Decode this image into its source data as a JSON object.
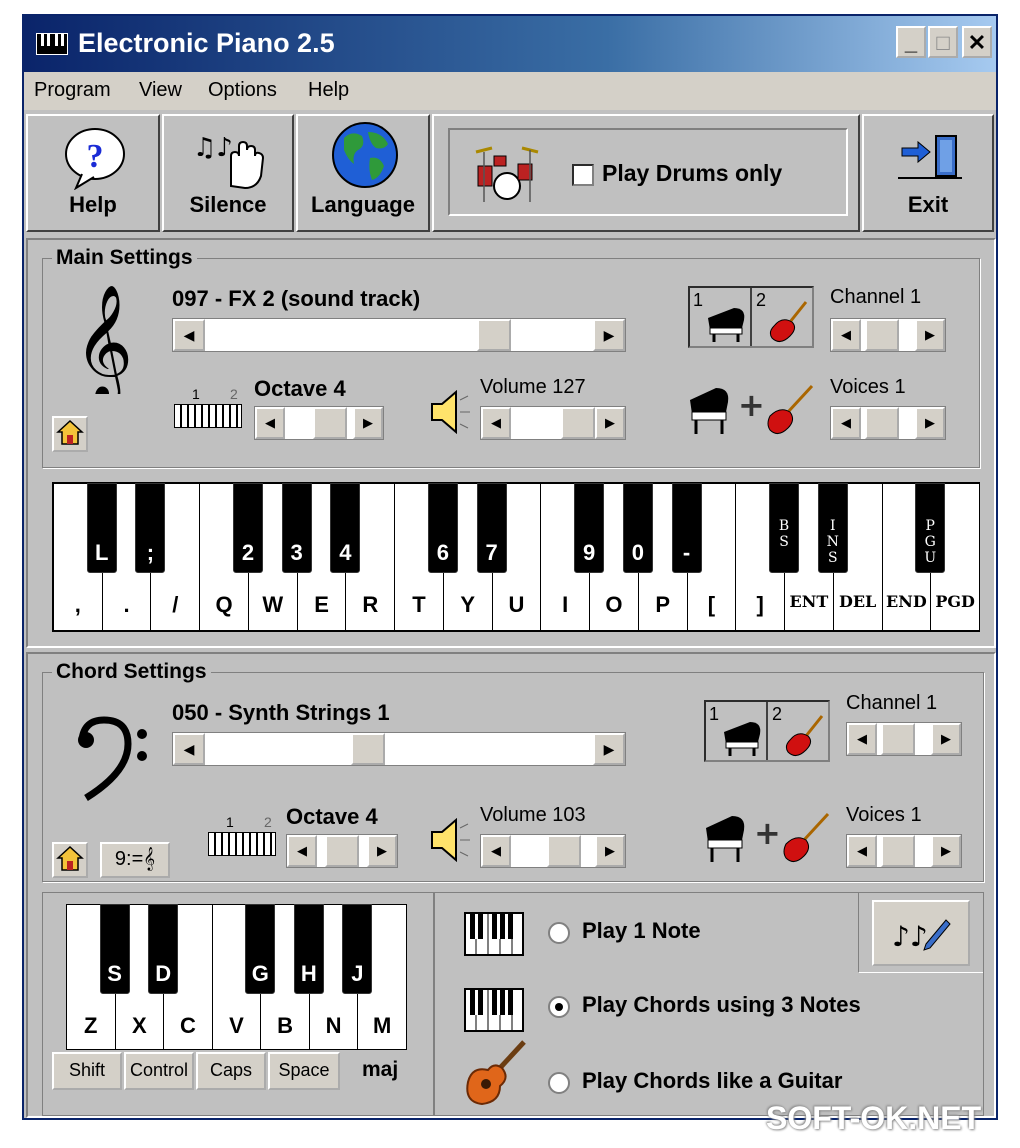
{
  "window": {
    "title": "Electronic Piano 2.5",
    "controls": {
      "minimize": "_",
      "maximize": "□",
      "close": "✕"
    }
  },
  "menu": [
    "Program",
    "View",
    "Options",
    "Help"
  ],
  "toolbar": {
    "help": "Help",
    "silence": "Silence",
    "language": "Language",
    "drums_only": "Play Drums only",
    "drums_checked": false,
    "exit": "Exit"
  },
  "main_settings": {
    "title": "Main Settings",
    "instrument": "097 - FX 2 (sound track)",
    "instrument_level": 0.72,
    "octave": "Octave 4",
    "volume": "Volume 127",
    "channel": "Channel 1",
    "voices": "Voices 1",
    "mode_labels": [
      "1",
      "2"
    ],
    "octave_scale": [
      "1",
      "2"
    ]
  },
  "main_keyboard": {
    "white": [
      ",",
      ".",
      "/",
      "Q",
      "W",
      "E",
      "R",
      "T",
      "Y",
      "U",
      "I",
      "O",
      "P",
      "[",
      "]",
      "ENT",
      "DEL",
      "END",
      "PGD"
    ],
    "black": [
      "L",
      ";",
      "2",
      "3",
      "4",
      "6",
      "7",
      "9",
      "0",
      "-",
      "B\nS",
      "I\nN\nS",
      "P\nG\nU"
    ]
  },
  "chord_settings": {
    "title": "Chord Settings",
    "instrument": "050 - Synth Strings 1",
    "instrument_level": 0.43,
    "octave": "Octave 4",
    "volume": "Volume 103",
    "channel": "Channel 1",
    "voices": "Voices 1",
    "mode_labels": [
      "1",
      "2"
    ],
    "octave_scale": [
      "1",
      "2"
    ],
    "clef_equal_label": "9:=𝄞"
  },
  "chord_keyboard": {
    "white": [
      "Z",
      "X",
      "C",
      "V",
      "B",
      "N",
      "M"
    ],
    "black": [
      "S",
      "D",
      "G",
      "H",
      "J"
    ],
    "modifiers": [
      "Shift",
      "Control",
      "Caps",
      "Space"
    ],
    "chord_type": "maj"
  },
  "chord_modes": {
    "options": [
      "Play 1 Note",
      "Play Chords using 3 Notes",
      "Play Chords like a Guitar"
    ],
    "selected_index": 1
  },
  "watermark": "SOFT-OK.NET",
  "colors": {
    "title_start": "#0a246a",
    "title_end": "#a6caf0",
    "face": "#c0c0c0"
  }
}
